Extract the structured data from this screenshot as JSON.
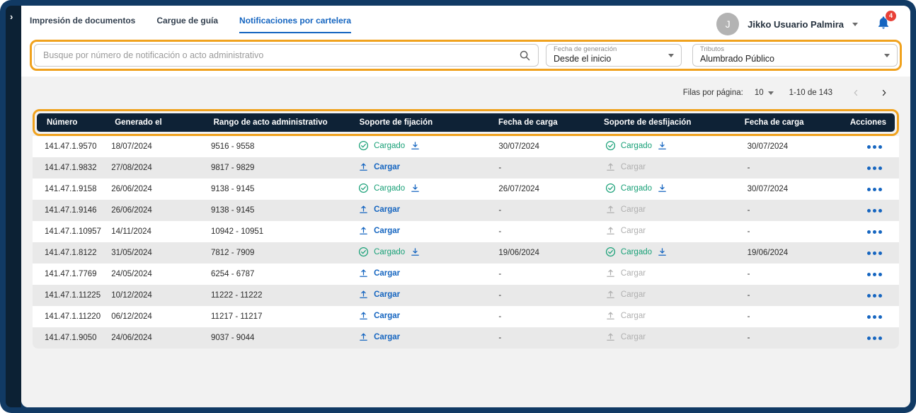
{
  "sidebar": {
    "expand_icon": "›"
  },
  "tabs": [
    {
      "label": "Impresión de documentos",
      "active": false
    },
    {
      "label": "Cargue de guía",
      "active": false
    },
    {
      "label": "Notificaciones por cartelera",
      "active": true
    }
  ],
  "user": {
    "avatar_initial": "J",
    "name": "Jikko Usuario Palmira",
    "notifications_count": "4"
  },
  "filters": {
    "search_placeholder": "Busque por número de notificación o acto administrativo",
    "date_filter": {
      "label": "Fecha de generación",
      "value": "Desde el inicio"
    },
    "tribute_filter": {
      "label": "Tributos",
      "value": "Alumbrado Público"
    }
  },
  "pagination": {
    "rows_per_page_label": "Filas por página:",
    "rows_per_page": "10",
    "range_label": "1-10 de 143"
  },
  "table": {
    "columns": [
      "Número",
      "Generado el",
      "Rango de acto administrativo",
      "Soporte de fijación",
      "Fecha de carga",
      "Soporte de desfijación",
      "Fecha de carga",
      "Acciones"
    ],
    "labels": {
      "cargado": "Cargado",
      "cargar": "Cargar"
    },
    "rows": [
      {
        "numero": "141.47.1.9570",
        "generado": "18/07/2024",
        "rango": "9516 - 9558",
        "fijacion": "cargado",
        "fecha_carga_fijacion": "30/07/2024",
        "desfijacion": "cargado",
        "fecha_carga_desfijacion": "30/07/2024"
      },
      {
        "numero": "141.47.1.9832",
        "generado": "27/08/2024",
        "rango": "9817 - 9829",
        "fijacion": "cargar",
        "fecha_carga_fijacion": "-",
        "desfijacion": "disabled",
        "fecha_carga_desfijacion": "-"
      },
      {
        "numero": "141.47.1.9158",
        "generado": "26/06/2024",
        "rango": "9138 - 9145",
        "fijacion": "cargado",
        "fecha_carga_fijacion": "26/07/2024",
        "desfijacion": "cargado",
        "fecha_carga_desfijacion": "30/07/2024"
      },
      {
        "numero": "141.47.1.9146",
        "generado": "26/06/2024",
        "rango": "9138 - 9145",
        "fijacion": "cargar",
        "fecha_carga_fijacion": "-",
        "desfijacion": "disabled",
        "fecha_carga_desfijacion": "-"
      },
      {
        "numero": "141.47.1.10957",
        "generado": "14/11/2024",
        "rango": "10942 - 10951",
        "fijacion": "cargar",
        "fecha_carga_fijacion": "-",
        "desfijacion": "disabled",
        "fecha_carga_desfijacion": "-"
      },
      {
        "numero": "141.47.1.8122",
        "generado": "31/05/2024",
        "rango": "7812 - 7909",
        "fijacion": "cargado",
        "fecha_carga_fijacion": "19/06/2024",
        "desfijacion": "cargado",
        "fecha_carga_desfijacion": "19/06/2024"
      },
      {
        "numero": "141.47.1.7769",
        "generado": "24/05/2024",
        "rango": "6254 - 6787",
        "fijacion": "cargar",
        "fecha_carga_fijacion": "-",
        "desfijacion": "disabled",
        "fecha_carga_desfijacion": "-"
      },
      {
        "numero": "141.47.1.11225",
        "generado": "10/12/2024",
        "rango": "11222 - 11222",
        "fijacion": "cargar",
        "fecha_carga_fijacion": "-",
        "desfijacion": "disabled",
        "fecha_carga_desfijacion": "-"
      },
      {
        "numero": "141.47.1.11220",
        "generado": "06/12/2024",
        "rango": "11217 - 11217",
        "fijacion": "cargar",
        "fecha_carga_fijacion": "-",
        "desfijacion": "disabled",
        "fecha_carga_desfijacion": "-"
      },
      {
        "numero": "141.47.1.9050",
        "generado": "24/06/2024",
        "rango": "9037 - 9044",
        "fijacion": "cargar",
        "fecha_carga_fijacion": "-",
        "desfijacion": "disabled",
        "fecha_carga_desfijacion": "-"
      }
    ]
  },
  "icons": {
    "search": "magnifier",
    "bell": "notification-bell",
    "check": "check-circle",
    "download": "download-arrow",
    "upload": "upload-arrow",
    "more_actions": "three-dots",
    "prev": "chevron-left",
    "next": "chevron-right"
  },
  "colors": {
    "accent_orange": "#F0A21E",
    "primary_blue": "#1565C0",
    "success_green": "#18A077",
    "header_navy": "#0E2236",
    "frame_navy": "#113A64",
    "badge_red": "#E84037",
    "row_alt_gray": "#E9E9E9"
  }
}
